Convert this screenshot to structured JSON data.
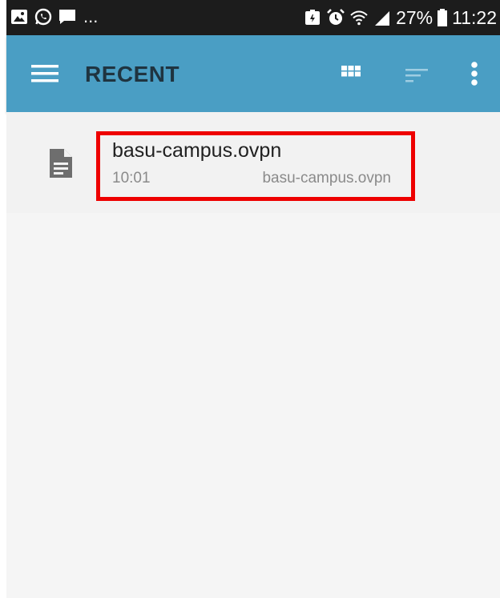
{
  "status_bar": {
    "overflow": "...",
    "battery_percent": "27%",
    "time": "11:22",
    "icons": [
      "image-icon",
      "whatsapp-icon",
      "message-icon",
      "battery-saver-icon",
      "alarm-icon",
      "wifi-icon",
      "signal-icon",
      "battery-icon"
    ]
  },
  "app_bar": {
    "title": "RECENT",
    "icons": [
      "menu-icon",
      "grid-view-icon",
      "sort-icon",
      "more-vert-icon"
    ]
  },
  "files": [
    {
      "name": "basu-campus.ovpn",
      "time": "10:01",
      "path": "basu-campus.ovpn",
      "icon": "document-icon",
      "highlighted": true
    }
  ],
  "colors": {
    "status_bar": "#1c1c1c",
    "app_bar": "#4a9ec4",
    "title": "#1f3440",
    "highlight": "#ee0000",
    "background": "#f5f5f5"
  }
}
